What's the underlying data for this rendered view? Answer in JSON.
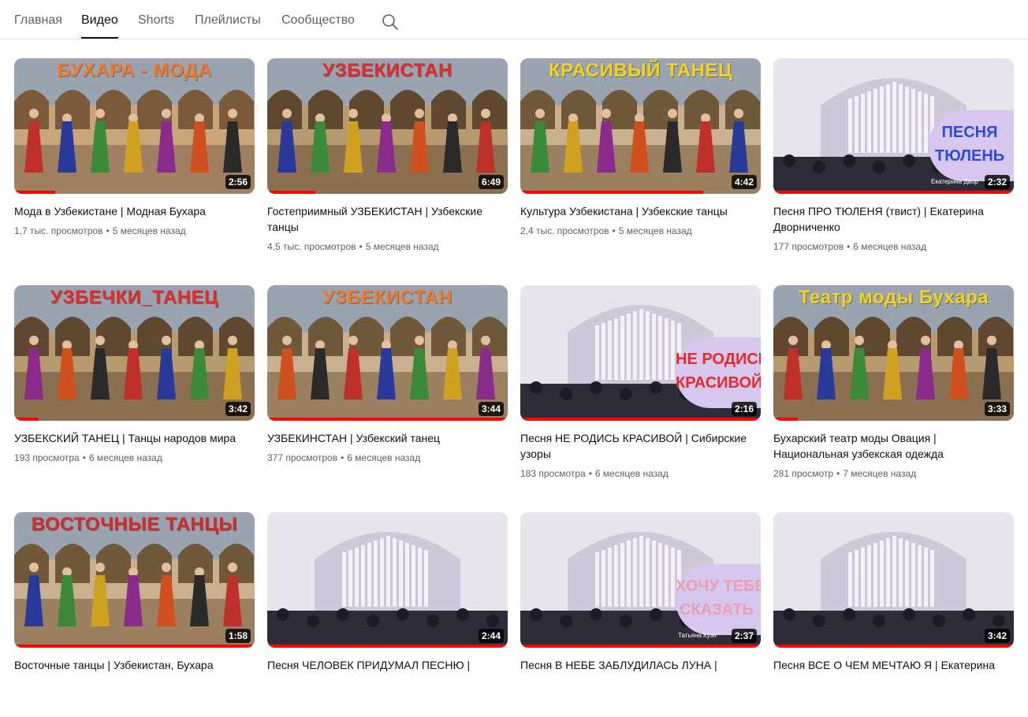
{
  "tabs": [
    {
      "label": "Главная",
      "active": false
    },
    {
      "label": "Видео",
      "active": true
    },
    {
      "label": "Shorts",
      "active": false
    },
    {
      "label": "Плейлисты",
      "active": false
    },
    {
      "label": "Сообщество",
      "active": false
    }
  ],
  "icons": {
    "search": "search-icon"
  },
  "colors": {
    "progress": "#ff0000",
    "text": "#0f0f0f",
    "meta": "#606060"
  },
  "videos": [
    {
      "title": "Мода в Узбекистане | Модная Бухара",
      "views": "1,7 тыс. просмотров",
      "age": "5 месяцев назад",
      "duration": "2:56",
      "progress": 0.17,
      "overlay": "БУХАРА - МОДА",
      "overlay_color": "#f07a2a",
      "bubble": [],
      "watermark": ""
    },
    {
      "title": "Гостеприимный УЗБЕКИСТАН | Узбекские танцы",
      "views": "4,5 тыс. просмотров",
      "age": "5 месяцев назад",
      "duration": "6:49",
      "progress": 0.2,
      "overlay": "УЗБЕКИСТАН",
      "overlay_color": "#e52a2a",
      "bubble": [],
      "watermark": ""
    },
    {
      "title": "Культура Узбекистана | Узбекские танцы",
      "views": "2,4 тыс. просмотров",
      "age": "5 месяцев назад",
      "duration": "4:42",
      "progress": 0.76,
      "overlay": "КРАСИВЫЙ ТАНЕЦ",
      "overlay_color": "#f5d21c",
      "bubble": [],
      "watermark": ""
    },
    {
      "title": "Песня ПРО ТЮЛЕНЯ (твист) | Екатерина Дворниченко",
      "views": "177 просмотров",
      "age": "6 месяцев назад",
      "duration": "2:32",
      "progress": 1.0,
      "overlay": "",
      "overlay_color": "#2a4bd6",
      "bubble": [
        "ПЕСНЯ",
        "ТЮЛЕНЬ"
      ],
      "watermark": "Екатерина Двор"
    },
    {
      "title": "УЗБЕКСКИЙ ТАНЕЦ | Танцы народов мира",
      "views": "193 просмотра",
      "age": "6 месяцев назад",
      "duration": "3:42",
      "progress": 0.1,
      "overlay": "УЗБЕЧКИ_ТАНЕЦ",
      "overlay_color": "#e52a2a",
      "bubble": [],
      "watermark": ""
    },
    {
      "title": "УЗБЕКИНСТАН | Узбекский танец",
      "views": "377 просмотров",
      "age": "6 месяцев назад",
      "duration": "3:44",
      "progress": 1.0,
      "overlay": "УЗБЕКИСТАН",
      "overlay_color": "#f07a2a",
      "bubble": [],
      "watermark": ""
    },
    {
      "title": "Песня НЕ РОДИСЬ КРАСИВОЙ | Сибирские узоры",
      "views": "183 просмотра",
      "age": "6 месяцев назад",
      "duration": "2:16",
      "progress": 1.0,
      "overlay": "",
      "overlay_color": "#e52a2a",
      "bubble": [
        "НЕ РОДИСЬ",
        "КРАСИВОЙ"
      ],
      "watermark": ""
    },
    {
      "title": "Бухарский театр моды Овация | Национальная узбекская одежда",
      "views": "281 просмотр",
      "age": "7 месяцев назад",
      "duration": "3:33",
      "progress": 0.1,
      "overlay": "Театр моды Бухара",
      "overlay_color": "#f5d21c",
      "bubble": [],
      "watermark": ""
    },
    {
      "title": "Восточные танцы | Узбекистан, Бухара",
      "views": "",
      "age": "",
      "duration": "1:58",
      "progress": 1.0,
      "overlay": "ВОСТОЧНЫЕ ТАНЦЫ",
      "overlay_color": "#d42a2a",
      "bubble": [],
      "watermark": ""
    },
    {
      "title": "Песня ЧЕЛОВЕК ПРИДУМАЛ ПЕСНЮ |",
      "views": "",
      "age": "",
      "duration": "2:44",
      "progress": 1.0,
      "overlay": "",
      "overlay_color": "#ffffff",
      "bubble": [],
      "watermark": ""
    },
    {
      "title": "Песня В НЕБЕ ЗАБЛУДИЛАСЬ ЛУНА |",
      "views": "",
      "age": "",
      "duration": "2:37",
      "progress": 1.0,
      "overlay": "",
      "overlay_color": "#e8a0b0",
      "bubble": [
        "ХОЧУ ТЕБЕ",
        "СКАЗАТЬ"
      ],
      "watermark": "Татьяна Кузн"
    },
    {
      "title": "Песня ВСЕ О ЧЕМ МЕЧТАЮ Я | Екатерина",
      "views": "",
      "age": "",
      "duration": "3:42",
      "progress": 1.0,
      "overlay": "",
      "overlay_color": "#ffffff",
      "bubble": [],
      "watermark": ""
    }
  ]
}
